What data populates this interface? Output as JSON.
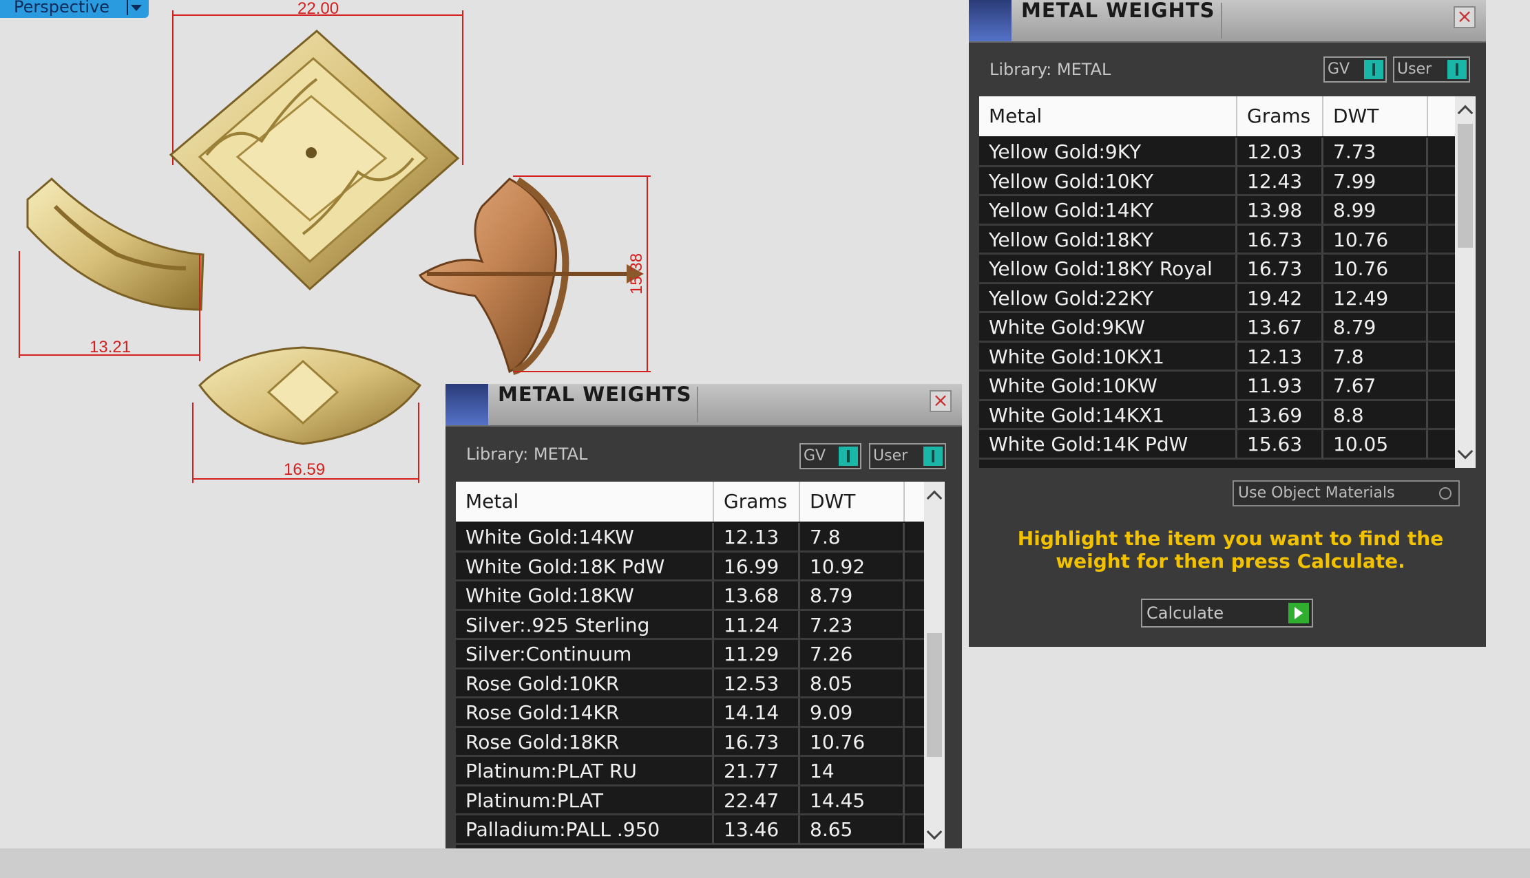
{
  "viewport": {
    "view_label": "Perspective",
    "dimensions": [
      "22.00",
      "15.38",
      "13.21",
      "16.59"
    ]
  },
  "dialog_left": {
    "title": "METAL WEIGHTS",
    "library_label": "Library: METAL",
    "gv_label": "GV",
    "user_label": "User",
    "columns": [
      "Metal",
      "Grams",
      "DWT"
    ],
    "rows": [
      [
        "White Gold:14KW",
        "12.13",
        "7.8"
      ],
      [
        "White Gold:18K PdW",
        "16.99",
        "10.92"
      ],
      [
        "White Gold:18KW",
        "13.68",
        "8.79"
      ],
      [
        "Silver:.925 Sterling",
        "11.24",
        "7.23"
      ],
      [
        "Silver:Continuum",
        "11.29",
        "7.26"
      ],
      [
        "Rose Gold:10KR",
        "12.53",
        "8.05"
      ],
      [
        "Rose Gold:14KR",
        "14.14",
        "9.09"
      ],
      [
        "Rose Gold:18KR",
        "16.73",
        "10.76"
      ],
      [
        "Platinum:PLAT RU",
        "21.77",
        "14"
      ],
      [
        "Platinum:PLAT",
        "22.47",
        "14.45"
      ],
      [
        "Palladium:PALL .950",
        "13.46",
        "8.65"
      ]
    ]
  },
  "dialog_right": {
    "title": "METAL WEIGHTS",
    "library_label": "Library: METAL",
    "gv_label": "GV",
    "user_label": "User",
    "columns": [
      "Metal",
      "Grams",
      "DWT"
    ],
    "rows": [
      [
        "Yellow Gold:9KY",
        "12.03",
        "7.73"
      ],
      [
        "Yellow Gold:10KY",
        "12.43",
        "7.99"
      ],
      [
        "Yellow Gold:14KY",
        "13.98",
        "8.99"
      ],
      [
        "Yellow Gold:18KY",
        "16.73",
        "10.76"
      ],
      [
        "Yellow Gold:18KY Royal",
        "16.73",
        "10.76"
      ],
      [
        "Yellow Gold:22KY",
        "19.42",
        "12.49"
      ],
      [
        "White Gold:9KW",
        "13.67",
        "8.79"
      ],
      [
        "White Gold:10KX1",
        "12.13",
        "7.8"
      ],
      [
        "White Gold:10KW",
        "11.93",
        "7.67"
      ],
      [
        "White Gold:14KX1",
        "13.69",
        "8.8"
      ],
      [
        "White Gold:14K PdW",
        "15.63",
        "10.05"
      ]
    ],
    "use_object_materials": "Use Object Materials",
    "hint": "Highlight the item you want to find the weight for then press Calculate.",
    "calculate_label": "Calculate"
  }
}
